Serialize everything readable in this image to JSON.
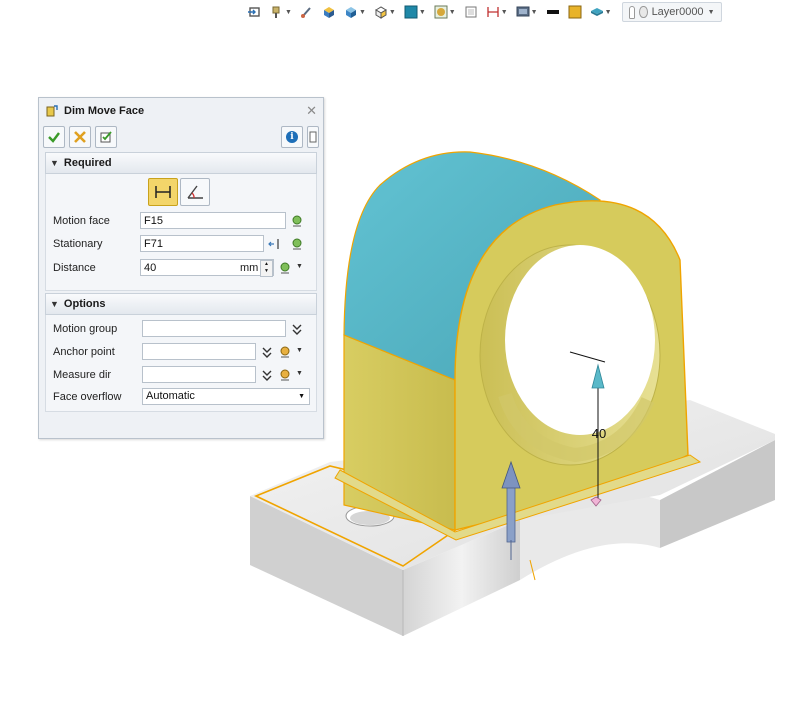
{
  "toolbar": {
    "icons": [
      "import-icon",
      "paint-icon",
      "brush-icon",
      "shade-icon",
      "cube-icon",
      "view-cube-icon",
      "color-icon",
      "render-icon",
      "frame-icon",
      "dimension-icon",
      "display-icon",
      "line-style-icon",
      "yellow-swatch-icon",
      "layer-style-icon"
    ],
    "layer_name": "Layer0000"
  },
  "dialog": {
    "title": "Dim Move Face",
    "required": {
      "header": "Required",
      "motion_face_label": "Motion face",
      "motion_face_value": "F15",
      "stationary_label": "Stationary",
      "stationary_value": "F71",
      "distance_label": "Distance",
      "distance_value": "40",
      "distance_unit": "mm"
    },
    "options": {
      "header": "Options",
      "motion_group_label": "Motion group",
      "motion_group_value": "",
      "anchor_point_label": "Anchor point",
      "anchor_point_value": "",
      "measure_dir_label": "Measure dir",
      "measure_dir_value": "",
      "face_overflow_label": "Face overflow",
      "face_overflow_value": "Automatic"
    }
  },
  "viewport": {
    "dimension_value": "40"
  },
  "colors": {
    "face_yellow": "#d9cf6a",
    "face_cyan": "#5ab9c9",
    "highlight_orange": "#f0a400",
    "panel_bg": "#eef1f5"
  }
}
